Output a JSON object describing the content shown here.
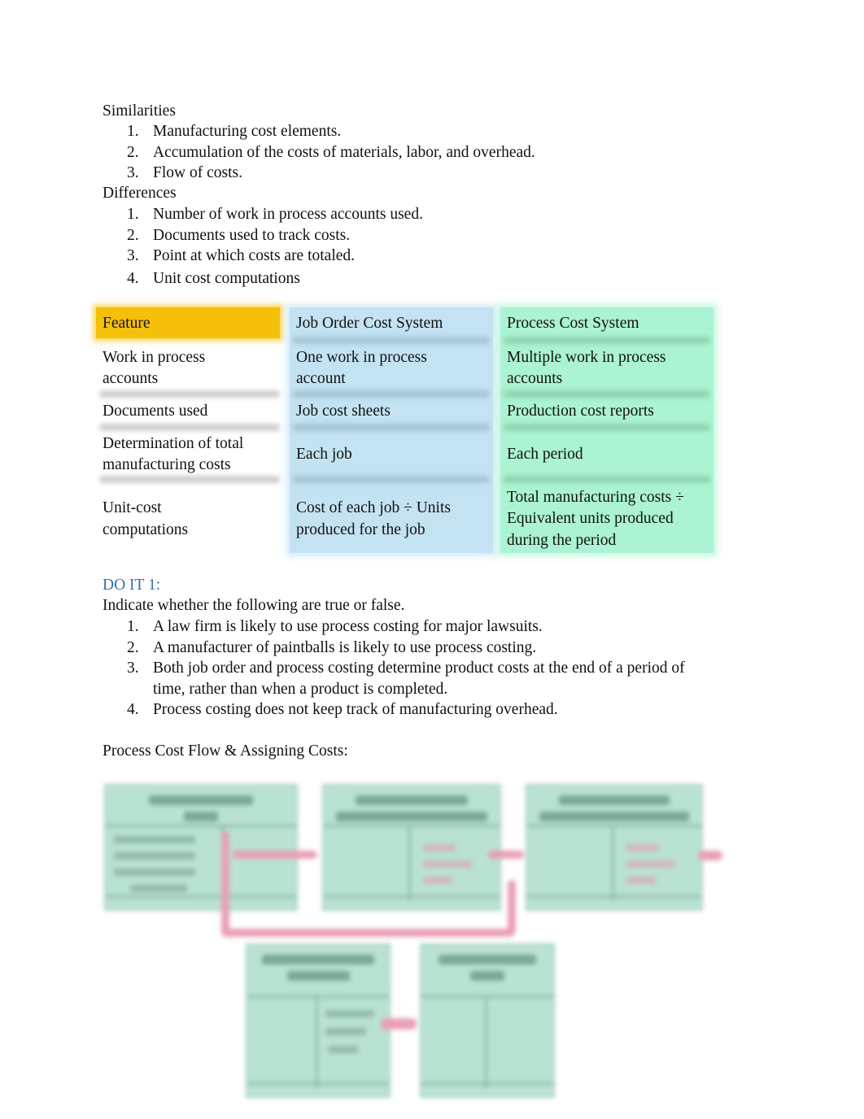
{
  "similarities": {
    "heading": "Similarities",
    "items": [
      {
        "num": "1.",
        "text": "Manufacturing cost elements."
      },
      {
        "num": "2.",
        "text": "Accumulation of the costs of materials, labor, and overhead."
      },
      {
        "num": "3.",
        "text": "Flow of costs."
      }
    ]
  },
  "differences": {
    "heading": "Differences",
    "items": [
      {
        "num": "1.",
        "text": "Number of work in process accounts used."
      },
      {
        "num": "2.",
        "text": "Documents used to track costs."
      },
      {
        "num": "3.",
        "text": "Point at which costs are totaled."
      },
      {
        "num": "4.",
        "text": "Unit cost computations"
      }
    ]
  },
  "comparison_table": {
    "colors": {
      "feature_header": "#f5c00a",
      "job_order": "#c3e3f3",
      "process": "#abf3d2"
    },
    "headers": [
      "Feature",
      "Job Order Cost System",
      "Process Cost System"
    ],
    "rows": [
      {
        "feature": [
          "Work in process",
          "accounts"
        ],
        "job": [
          "One work in process",
          "account"
        ],
        "process": [
          "Multiple work in process",
          "accounts"
        ]
      },
      {
        "feature": [
          "Documents used"
        ],
        "job": [
          "Job cost sheets"
        ],
        "process": [
          "Production cost reports"
        ]
      },
      {
        "feature": [
          "Determination of total",
          "manufacturing costs"
        ],
        "job": [
          "Each job"
        ],
        "process": [
          "Each period"
        ]
      },
      {
        "feature": [
          "Unit-cost",
          "computations"
        ],
        "job": [
          "Cost of each job ÷ Units",
          "produced for the job"
        ],
        "process": [
          "Total manufacturing costs ÷",
          "Equivalent units produced",
          "during the period"
        ]
      }
    ]
  },
  "do_it": {
    "title": "DO IT 1:",
    "title_color": "#2e74b5",
    "instruction": "Indicate whether the following are  true  or false.",
    "items": [
      {
        "num": "1.",
        "lines": [
          "A law firm is likely to use process costing for major lawsuits."
        ]
      },
      {
        "num": "2.",
        "lines": [
          "A manufacturer of paintballs is likely to use process costing."
        ]
      },
      {
        "num": "3.",
        "lines": [
          "Both job order and process costing determine product costs at the end of a period of",
          "time, rather than when a product is completed."
        ]
      },
      {
        "num": "4.",
        "lines": [
          "Process costing does not keep track of manufacturing overhead."
        ]
      }
    ]
  },
  "process_flow": {
    "heading": "Process Cost Flow & Assigning Costs:",
    "diagram_note": "blurred diagram of T-accounts connected by arrows (text illegible)",
    "colors": {
      "account_fill": "#b9e2d2",
      "arrow": "#e8a0b4"
    }
  }
}
